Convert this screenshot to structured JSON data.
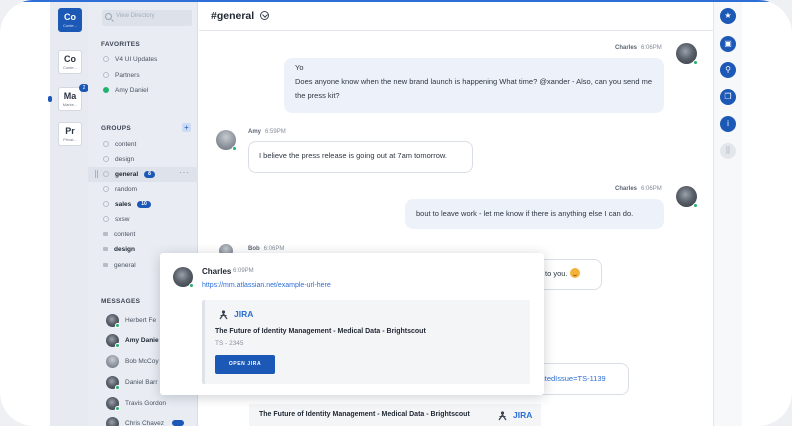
{
  "teams": [
    {
      "abbr": "Co",
      "sub": "Conte..."
    },
    {
      "abbr": "Co",
      "sub": "Conte..."
    },
    {
      "abbr": "Ma",
      "sub": "Marke...",
      "badge": "2"
    },
    {
      "abbr": "Pr",
      "sub": "Privat..."
    }
  ],
  "sidebar": {
    "search_placeholder": "View Directory",
    "favorites_title": "FAVORITES",
    "favorites": [
      "V4 UI Updates",
      "Partners",
      "Amy Daniel"
    ],
    "groups_title": "GROUPS",
    "groups": [
      {
        "label": "content"
      },
      {
        "label": "design"
      },
      {
        "label": "general",
        "badge": "8"
      },
      {
        "label": "random"
      },
      {
        "label": "sales",
        "badge": "10"
      },
      {
        "label": "sxsw"
      },
      {
        "label": "content"
      },
      {
        "label": "design"
      },
      {
        "label": "general"
      }
    ],
    "messages_title": "MESSAGES",
    "messages": [
      "Herbert Fe",
      "Amy Danie",
      "Bob McCoy",
      "Daniel Barr",
      "Travis Gordon",
      "Chris Chavez"
    ]
  },
  "channel": {
    "title": "#general"
  },
  "messages": [
    {
      "author": "Charles",
      "time": "6:06PM",
      "text": "Yo\nDoes anyone know when the new brand launch is happening What time? @xander - Also, can you send me the press kit?"
    },
    {
      "author": "Amy",
      "time": "6:59PM",
      "text": "I believe the press release is going out at 7am tomorrow."
    },
    {
      "author": "Charles",
      "time": "6:06PM",
      "text": "bout to leave work - let me know if there is anything else I can do."
    },
    {
      "author": "Bob",
      "time": "6:06PM",
      "text": "to you."
    },
    {
      "link_fragment": "ctedIssue=TS-1139"
    }
  ],
  "bottom_card": {
    "title": "The Future of Identity Management - Medical Data - Brightscout",
    "brand": "JIRA"
  },
  "popup": {
    "author": "Charles",
    "time": "6:09PM",
    "url": "https://mm.atlassian.net/example-url-here",
    "embed": {
      "brand": "JIRA",
      "title": "The Future of Identity Management - Medical Data - Brightscout",
      "issue": "TS - 2345",
      "button": "OPEN JIRA"
    }
  },
  "right_rail_icons": [
    "star-icon",
    "notebook-icon",
    "pin-icon",
    "files-icon",
    "info-icon",
    "apps-icon"
  ]
}
